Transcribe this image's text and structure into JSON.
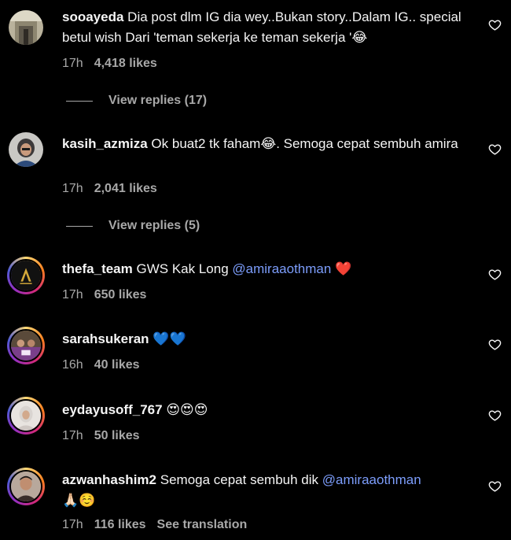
{
  "comments": [
    {
      "username": "sooayeda",
      "text": "Dia post dlm IG dia wey..Bukan story..Dalam IG.. special betul wish Dari 'teman sekerja ke teman sekerja '😂",
      "time": "17h",
      "likes": "4,418 likes",
      "view_replies": "View replies (17)"
    },
    {
      "username": "kasih_azmiza",
      "text": "Ok buat2 tk faham😂. Semoga cepat sembuh amira",
      "time": "17h",
      "likes": "2,041 likes",
      "view_replies": "View replies (5)"
    },
    {
      "username": "thefa_team",
      "text_before": "GWS Kak Long",
      "mention": "@amiraaothman",
      "text_after": "❤️",
      "time": "17h",
      "likes": "650 likes"
    },
    {
      "username": "sarahsukeran",
      "text": "💙💙",
      "time": "16h",
      "likes": "40 likes"
    },
    {
      "username": "eydayusoff_767",
      "text": "😍😍😍",
      "time": "17h",
      "likes": "50 likes"
    },
    {
      "username": "azwanhashim2",
      "text_before": "Semoga cepat sembuh dik",
      "mention": "@amiraaothman",
      "text_after": "🙏🏻☺️",
      "time": "17h",
      "likes": "116 likes",
      "see_translation": "See translation"
    }
  ],
  "icons": {
    "like": "heart-outline-icon"
  },
  "colors": {
    "background": "#000000",
    "text": "#f5f5f5",
    "secondary": "#a8a8a8",
    "mention": "#7c9dfb"
  }
}
